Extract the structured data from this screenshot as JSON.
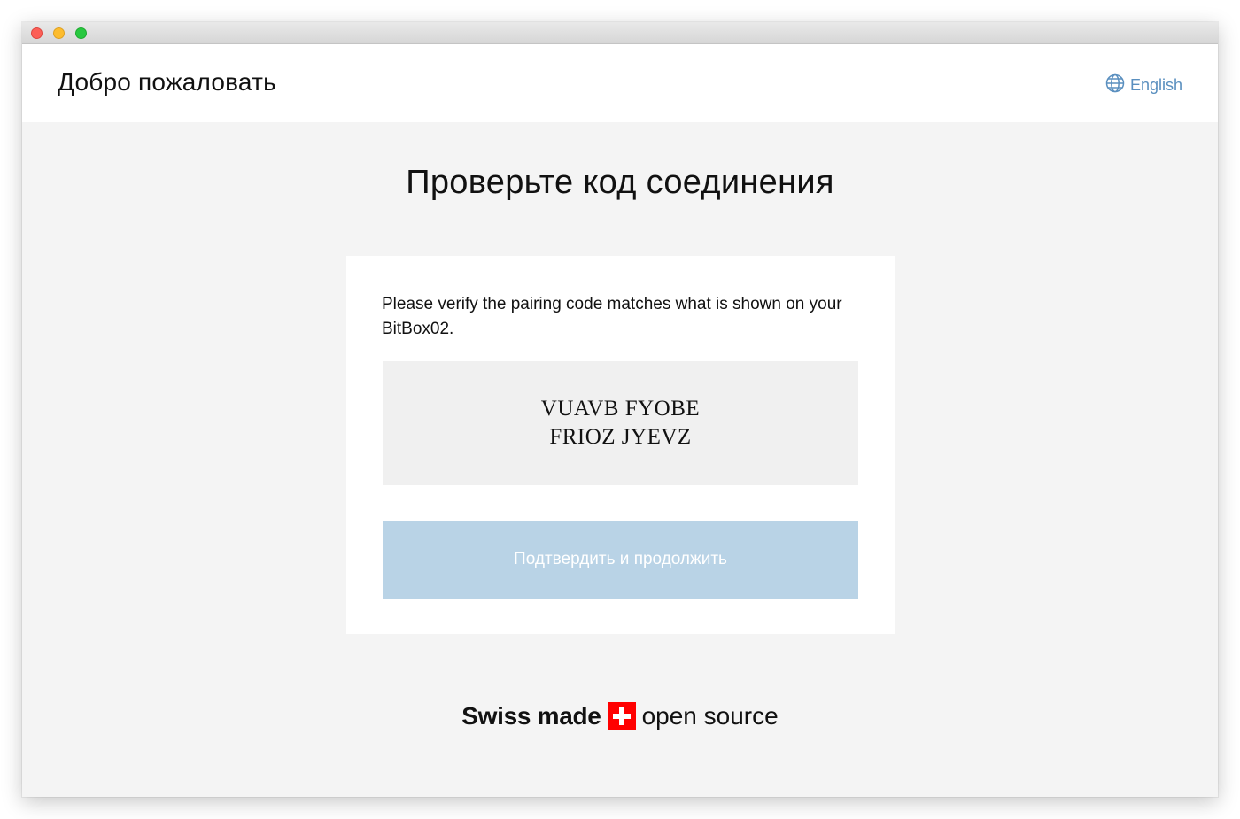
{
  "header": {
    "title": "Добро пожаловать",
    "language_label": "English",
    "language_icon": "globe-icon"
  },
  "main": {
    "title": "Проверьте код соединения",
    "description": "Please verify the pairing code matches what is shown on your BitBox02.",
    "pairing_code": {
      "line1": "VUAVB FYOBE",
      "line2": "FRIOZ JYEVZ"
    },
    "continue_label": "Подтвердить и продолжить"
  },
  "footer": {
    "swiss_made": "Swiss made",
    "open_source": "open source",
    "flag_icon": "swiss-flag-icon"
  },
  "colors": {
    "accent": "#5a8fbf",
    "button_disabled": "#b9d3e6",
    "background": "#f4f4f4",
    "swiss_red": "#ff0000"
  }
}
